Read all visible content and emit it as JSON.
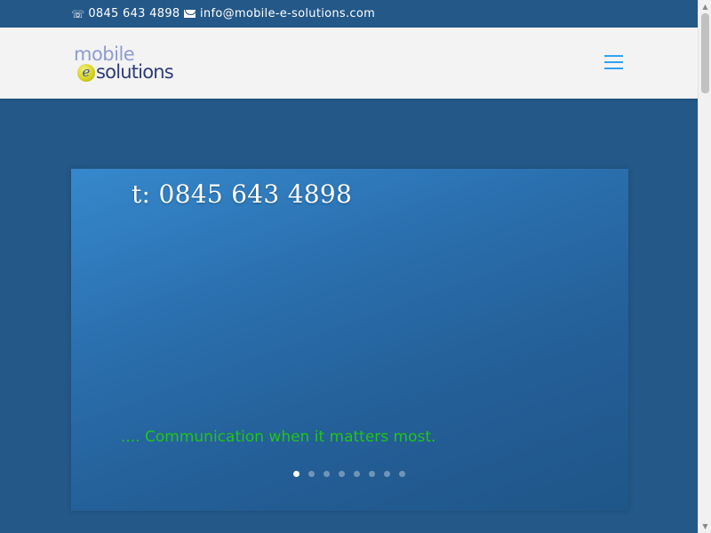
{
  "topbar": {
    "phone": "0845 643 4898",
    "email": "info@mobile-e-solutions.com",
    "phone_icon": "☏",
    "mail_icon": "envelope-icon"
  },
  "header": {
    "logo": {
      "line1": "mobile",
      "e_letter": "e",
      "line2": "solutions"
    },
    "menu_icon": "hamburger-icon"
  },
  "slider": {
    "phone_text": "t: 0845 643 4898",
    "tagline": ".... Communication when it matters most.",
    "dot_count": 8,
    "active_dot": 0
  },
  "colors": {
    "page_bg": "#235888",
    "header_bg": "#f3f3f3",
    "accent": "#2ea3f2",
    "tagline": "#22c418"
  },
  "scrollbar": {
    "up_arrow": "▲",
    "down_arrow": "▼"
  }
}
